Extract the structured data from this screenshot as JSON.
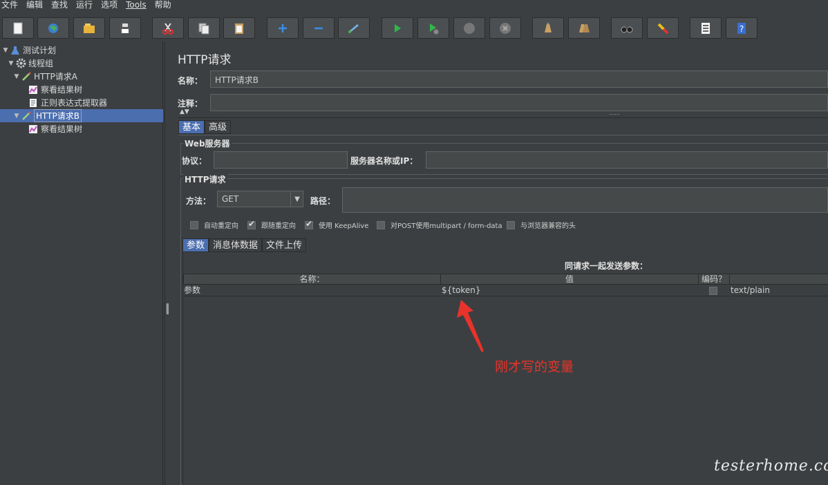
{
  "menu": [
    "文件",
    "编辑",
    "查找",
    "运行",
    "选项",
    "Tools",
    "帮助"
  ],
  "toolbar": {
    "buttons": [
      "new-icon",
      "templates-icon",
      "open-icon",
      "save-icon",
      "cut-icon",
      "copy-icon",
      "paste-icon",
      "expand-icon",
      "collapse-icon",
      "toggle-icon",
      "start-icon",
      "start-no-pause-icon",
      "stop-icon",
      "shutdown-icon",
      "clear-icon",
      "clear-all-icon",
      "search-icon",
      "reset-search-icon",
      "function-helper-icon",
      "help-icon"
    ]
  },
  "tree": {
    "items": [
      {
        "label": "测试计划"
      },
      {
        "label": "线程组"
      },
      {
        "label": "HTTP请求A"
      },
      {
        "label": "察看结果树"
      },
      {
        "label": "正则表达式提取器"
      },
      {
        "label": "HTTP请求B"
      },
      {
        "label": "察看结果树"
      }
    ]
  },
  "panel": {
    "title": "HTTP请求",
    "name_label": "名称：",
    "name_value": "HTTP请求B",
    "comment_label": "注释：",
    "comment_value": "",
    "tabs": [
      "基本",
      "高级"
    ],
    "web_server": {
      "title": "Web服务器",
      "protocol_label": "协议：",
      "protocol_value": "",
      "server_label": "服务器名称或IP：",
      "server_value": ""
    },
    "http_request": {
      "title": "HTTP请求",
      "method_label": "方法：",
      "method_value": "GET",
      "path_label": "路径：",
      "path_value": ""
    },
    "checkboxes": [
      {
        "label": "自动重定向",
        "checked": false
      },
      {
        "label": "跟随重定向",
        "checked": true
      },
      {
        "label": "使用 KeepAlive",
        "checked": true
      },
      {
        "label": "对POST使用multipart / form-data",
        "checked": false
      },
      {
        "label": "与浏览器兼容的头",
        "checked": false
      }
    ],
    "sub_tabs": [
      "参数",
      "消息体数据",
      "文件上传"
    ],
    "params": {
      "heading": "同请求一起发送参数：",
      "columns": [
        "名称：",
        "值",
        "编码？",
        ""
      ],
      "rows": [
        {
          "name": "参数",
          "value": "${token}",
          "encode": false,
          "content_type": "text/plain"
        }
      ]
    }
  },
  "annotation": "刚才写的变量",
  "watermark": "testerhome.com",
  "colors": {
    "selection": "#4b6eaf",
    "annotation": "#e8332a",
    "background": "#3c3f41"
  }
}
